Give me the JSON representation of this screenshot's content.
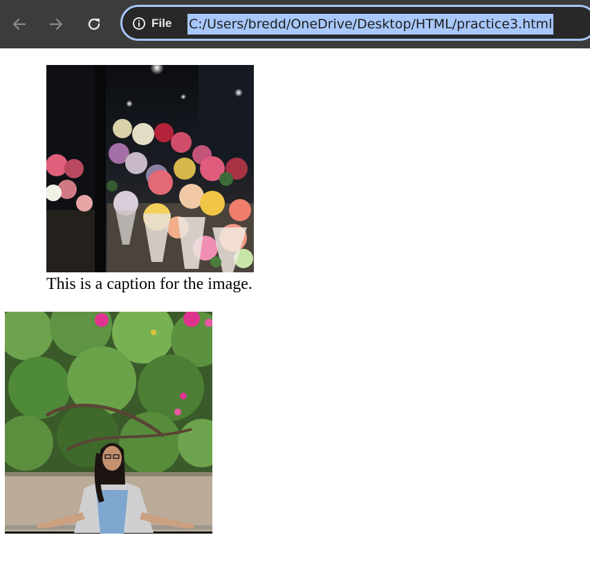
{
  "browser": {
    "site_info_label": "File",
    "url": "C:/Users/bredd/OneDrive/Desktop/HTML/practice3.html",
    "icons": [
      "back-arrow-icon",
      "forward-arrow-icon",
      "reload-icon",
      "info-icon"
    ]
  },
  "page": {
    "figure1": {
      "caption": "This is a caption for the image."
    }
  },
  "colors": {
    "toolbar": "#3c3c3c",
    "omnibox_border": "#a8c7fa",
    "url_selection": "#a8c7fa",
    "page_background": "#ffffff"
  }
}
